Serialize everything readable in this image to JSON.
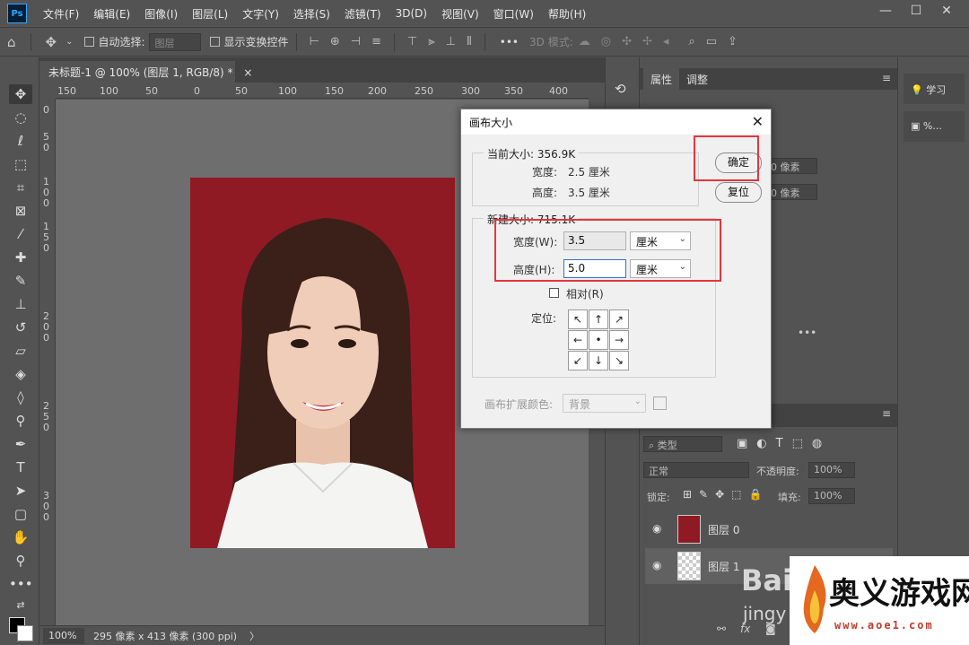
{
  "app": {
    "logo": "Ps"
  },
  "menu": [
    "文件(F)",
    "编辑(E)",
    "图像(I)",
    "图层(L)",
    "文字(Y)",
    "选择(S)",
    "滤镜(T)",
    "3D(D)",
    "视图(V)",
    "窗口(W)",
    "帮助(H)"
  ],
  "window_controls": {
    "minimize": "—",
    "maximize": "☐",
    "close": "✕"
  },
  "options": {
    "auto_select_label": "自动选择:",
    "auto_select_value": "图层",
    "show_transform_label": "显示变换控件",
    "more": "•••",
    "mode3d_label": "3D 模式:"
  },
  "document": {
    "tab_title": "未标题-1 @ 100% (图层 1, RGB/8) *",
    "tab_close": "×"
  },
  "ruler": {
    "h_labels": [
      "150",
      "100",
      "50",
      "0",
      "50",
      "100",
      "150",
      "200",
      "250",
      "300",
      "350",
      "400"
    ],
    "v_labels": [
      "0",
      "5",
      "0",
      "1",
      "0",
      "0",
      "1",
      "5",
      "0",
      "2",
      "0",
      "0",
      "2",
      "5",
      "0",
      "3",
      "0",
      "0"
    ]
  },
  "status": {
    "zoom": "100%",
    "info": "295 像素 x 413 像素 (300 ppi)",
    "arrow": "〉"
  },
  "properties_panel": {
    "tabs": [
      "属性",
      "调整"
    ],
    "fields": [
      "0 像素",
      "0 像素"
    ],
    "more": "•••"
  },
  "layers_panel": {
    "kind_label": "类型",
    "blend_mode": "正常",
    "opacity_label": "不透明度:",
    "opacity_value": "100%",
    "lock_label": "锁定:",
    "fill_label": "填充:",
    "fill_value": "100%",
    "layers": [
      {
        "name": "图层 0",
        "selected": false
      },
      {
        "name": "图层 1",
        "selected": true
      }
    ],
    "fx": "fx"
  },
  "learn_panel": {
    "learn": "学习",
    "percent": "%..."
  },
  "dialog": {
    "title": "画布大小",
    "current_legend": "当前大小: 356.9K",
    "current_width_label": "宽度:",
    "current_width_value": "2.5 厘米",
    "current_height_label": "高度:",
    "current_height_value": "3.5 厘米",
    "new_legend": "新建大小: 715.1K",
    "width_label": "宽度(W):",
    "width_value": "3.5",
    "width_unit": "厘米",
    "height_label": "高度(H):",
    "height_value": "5.0",
    "height_unit": "厘米",
    "relative_label": "相对(R)",
    "anchor_label": "定位:",
    "anchor_arrows": [
      "↖",
      "↑",
      "↗",
      "←",
      "•",
      "→",
      "↙",
      "↓",
      "↘"
    ],
    "ext_color_label": "画布扩展颜色:",
    "ext_color_value": "背景",
    "ok": "确定",
    "reset": "复位"
  },
  "watermark": {
    "title": "奥义游戏网",
    "url": "www.aoe1.com",
    "baidu": "Bai",
    "jingyan": "jingy"
  },
  "colors": {
    "photo_background": "#8f1a24",
    "highlight_box": "#e6353c",
    "panel": "#535353"
  }
}
